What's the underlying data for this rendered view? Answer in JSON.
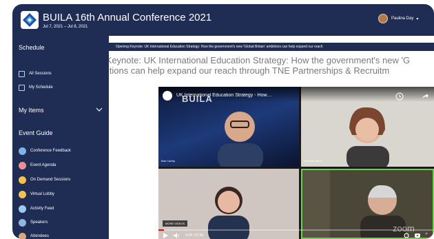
{
  "header": {
    "title": "BUILA 16th Annual Conference 2021",
    "dates": "Jul 7, 2021 – Jul 8, 2021",
    "user_name": "Paulina Day",
    "colors": {
      "bar": "#1f2c54",
      "text": "#ffffff"
    }
  },
  "sidebar": {
    "schedule_heading": "Schedule",
    "schedule_items": [
      {
        "label": "All Sessions",
        "icon": "calendar-icon"
      },
      {
        "label": "My Schedule",
        "icon": "calendar-check-icon"
      }
    ],
    "my_items_heading": "My Items",
    "event_guide_heading": "Event Guide",
    "event_guide_items": [
      {
        "label": "Conference Feedback",
        "icon": "feedback-icon",
        "color": "#7fb3e8"
      },
      {
        "label": "Event Agenda",
        "icon": "agenda-icon",
        "color": "#ef8f8f"
      },
      {
        "label": "On Demand Sessions",
        "icon": "on-demand-icon",
        "color": "#f2c14e"
      },
      {
        "label": "Virtual Lobby",
        "icon": "lobby-icon",
        "color": "#f2c14e"
      },
      {
        "label": "Activity Feed",
        "icon": "activity-icon",
        "color": "#9fc9ef"
      },
      {
        "label": "Speakers",
        "icon": "speakers-icon",
        "color": "#8fb7e0"
      },
      {
        "label": "Attendees",
        "icon": "attendees-icon",
        "color": "#d8a878"
      }
    ]
  },
  "session": {
    "strip_title": "Opening Keynote: UK International Education Strategy: How the government's new 'Global Britain' ambitions can help expand our reach",
    "title_line1": "Opening Keynote: UK International Education Strategy: How the government's new 'G",
    "title_line2": "ambitions can help expand our reach through TNE Partnerships & Recruitm"
  },
  "video": {
    "title": "UK International Education Strategy - How the government's new 'Global Britain' ambitions can help expand our reach through partnersh...",
    "watermark": "BUILA",
    "watch_later": "Watch later",
    "share": "Share",
    "tile1_name": "Bob Carthy",
    "tile2_name": "Vivienne Stern",
    "more_videos": "MORE VIDEOS",
    "time": "0:04 / 57:46",
    "zoom_watermark": "zoom",
    "progress_percent": 2
  }
}
